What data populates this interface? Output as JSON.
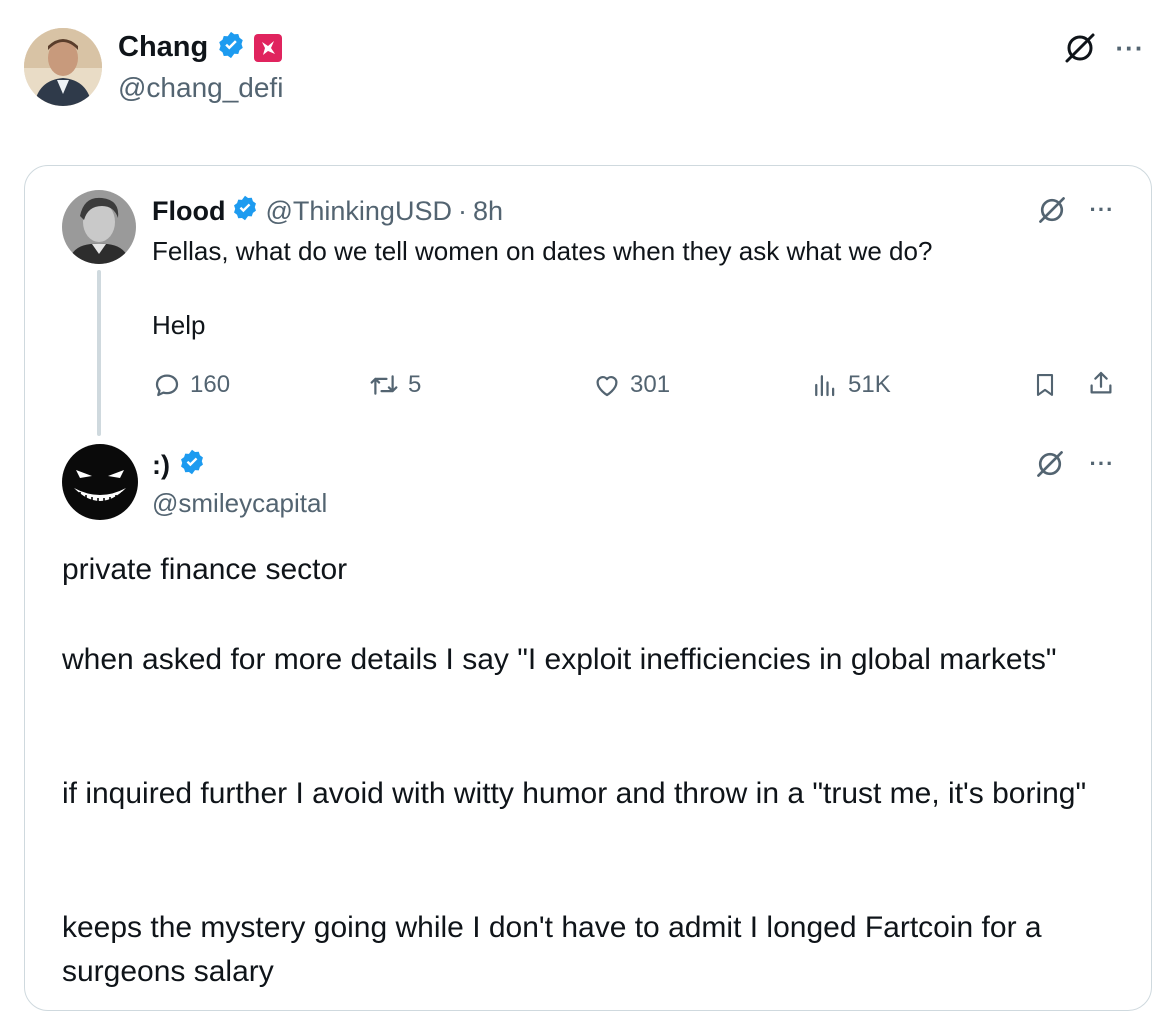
{
  "outer_tweet": {
    "display_name": "Chang",
    "handle": "@chang_defi"
  },
  "quoted_tweet": {
    "display_name": "Flood",
    "handle": "@ThinkingUSD",
    "separator": "·",
    "time": "8h",
    "text_line1": "Fellas, what do we tell women on dates when they ask what we do?",
    "text_line2": "Help",
    "stats": {
      "replies": "160",
      "reposts": "5",
      "likes": "301",
      "views": "51K"
    }
  },
  "reply_tweet": {
    "display_name": ":)",
    "handle": "@smileycapital",
    "paragraphs": [
      "private finance sector",
      "when asked for more details I say \"I exploit inefficiencies in global markets\"",
      "if inquired further I avoid with witty humor and throw in a \"trust me, it's boring\"",
      "keeps the mystery going while I don't have to admit I longed Fartcoin for a surgeons salary"
    ]
  },
  "colors": {
    "verified": "#1d9bf0",
    "text": "#0f1419",
    "muted": "#536471",
    "border": "#cfd9de",
    "badge_red": "#e0245e"
  },
  "icons": [
    "verified-badge-icon",
    "red-flair-icon",
    "grok-icon",
    "more-icon",
    "reply-icon",
    "repost-icon",
    "like-icon",
    "views-icon",
    "bookmark-icon",
    "share-icon"
  ]
}
